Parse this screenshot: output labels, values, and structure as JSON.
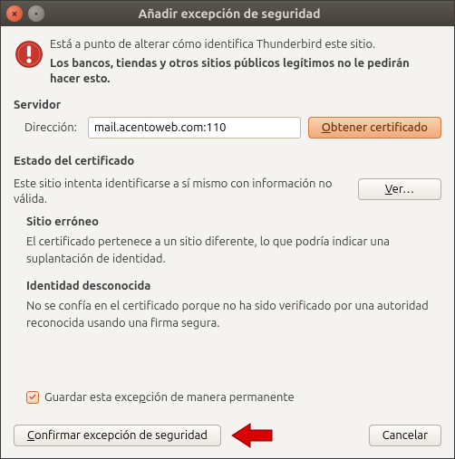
{
  "window": {
    "title": "Añadir excepción de seguridad"
  },
  "intro": {
    "line1": "Está a punto de alterar cómo identifica Thunderbird este sitio.",
    "line2": "Los bancos, tiendas y otros sitios públicos legítimos no le pedirán hacer esto."
  },
  "server": {
    "heading": "Servidor",
    "address_label": "Dirección:",
    "address_value": "mail.acentoweb.com:110",
    "get_cert_btn": "Obtener certificado"
  },
  "status": {
    "heading": "Estado del certificado",
    "desc": "Este sitio intenta identificarse a sí mismo con información no válida.",
    "view_btn": "Ver…",
    "wrong_site_h": "Sitio erróneo",
    "wrong_site_p": "El certificado pertenece a un sitio diferente, lo que podría indicar una suplantación de identidad.",
    "unknown_h": "Identidad desconocida",
    "unknown_p": "No se confía en el certificado porque no ha sido verificado por una autoridad reconocida usando una firma segura."
  },
  "checkbox": {
    "label": "Guardar esta excepción de manera permanente",
    "checked": true
  },
  "buttons": {
    "confirm": "Confirmar excepción de seguridad",
    "cancel": "Cancelar"
  }
}
